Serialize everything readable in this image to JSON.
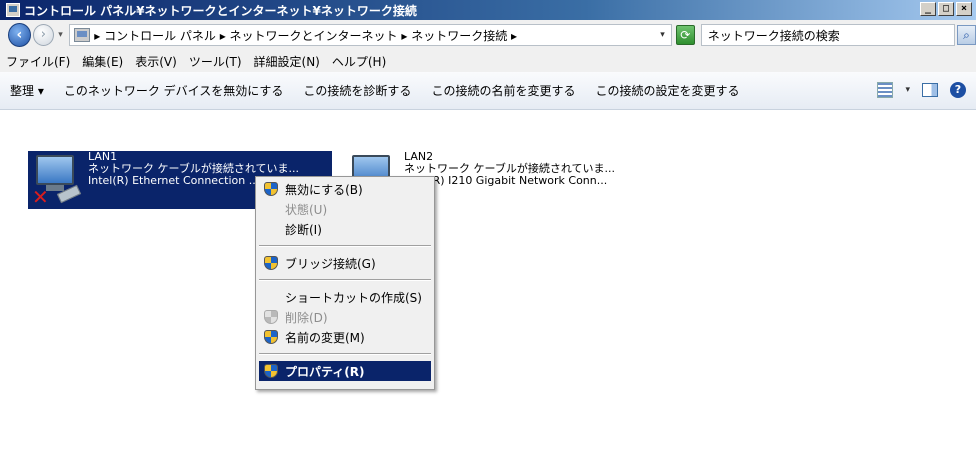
{
  "window": {
    "title": "コントロール パネル¥ネットワークとインターネット¥ネットワーク接続",
    "minimize": "_",
    "maximize": "□",
    "close": "×"
  },
  "address": {
    "crumbs": "▸ コントロール パネル ▸ ネットワークとインターネット ▸ ネットワーク接続 ▸",
    "search_placeholder": "ネットワーク接続の検索"
  },
  "menu": {
    "file": "ファイル(F)",
    "edit": "編集(E)",
    "view": "表示(V)",
    "tools": "ツール(T)",
    "advanced": "詳細設定(N)",
    "help": "ヘルプ(H)"
  },
  "commands": {
    "organize": "整理 ▾",
    "disable": "このネットワーク デバイスを無効にする",
    "diagnose": "この接続を診断する",
    "rename": "この接続の名前を変更する",
    "settings": "この接続の設定を変更する"
  },
  "connections": [
    {
      "name": "LAN1",
      "status": "ネットワーク ケーブルが接続されていま...",
      "adapter": "Intel(R) Ethernet Connection ..."
    },
    {
      "name": "LAN2",
      "status": "ネットワーク ケーブルが接続されていま...",
      "adapter": "Intel(R) I210 Gigabit Network Conn..."
    }
  ],
  "context_menu": {
    "disable": "無効にする(B)",
    "status": "状態(U)",
    "diagnose": "診断(I)",
    "bridge": "ブリッジ接続(G)",
    "shortcut": "ショートカットの作成(S)",
    "delete": "削除(D)",
    "rename": "名前の変更(M)",
    "properties": "プロパティ(R)"
  }
}
